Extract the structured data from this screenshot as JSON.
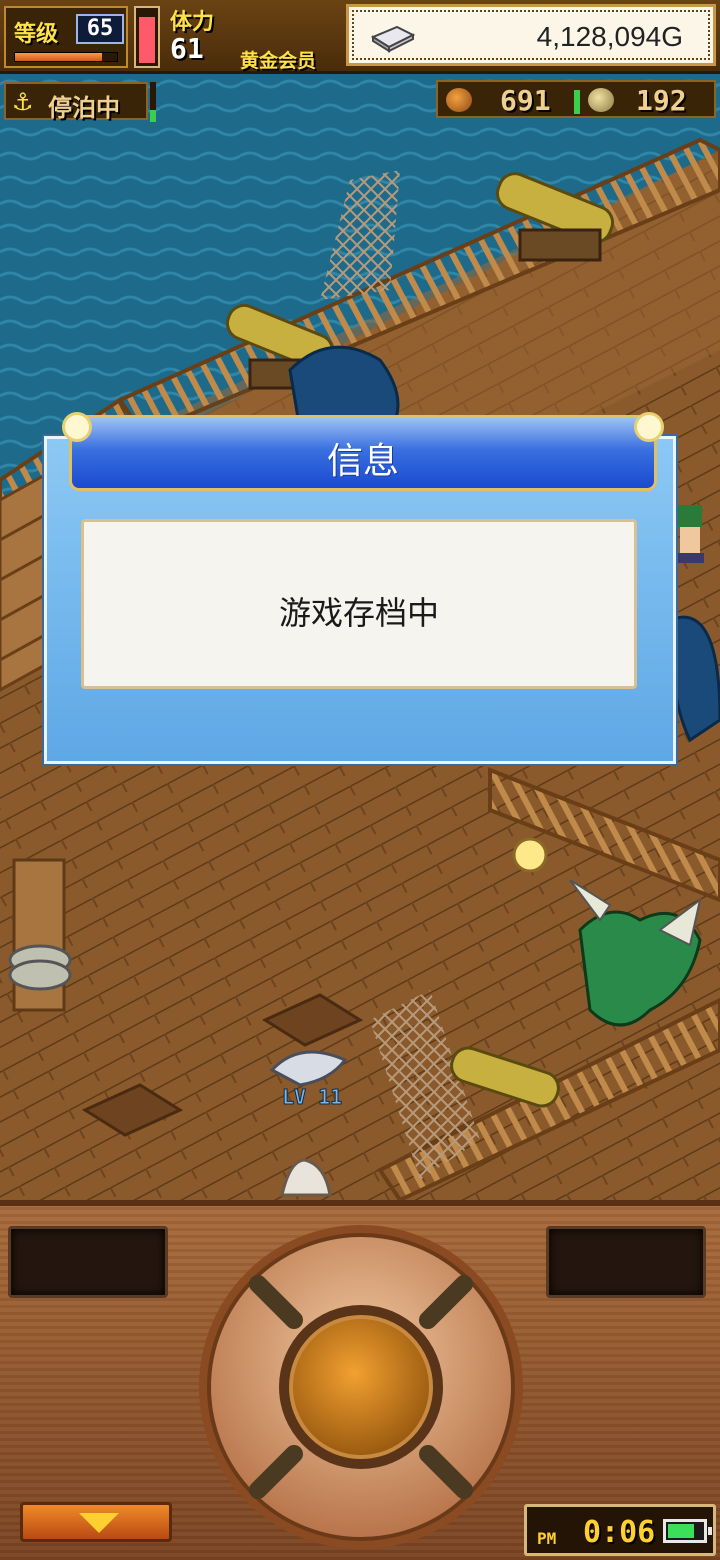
{
  "hud": {
    "level_label": "等级",
    "level": "65",
    "level_progress": 0.85,
    "stamina_label": "体力",
    "stamina": "61",
    "stamina_fill": 0.9,
    "member_label": "黄金会员",
    "gold": "4,128,094G",
    "status_label": "停泊中",
    "resource_1": "691",
    "resource_2": "192"
  },
  "dialog": {
    "title": "信息",
    "message": "游戏存档中"
  },
  "panel": {
    "clock_ampm": "PM",
    "clock_time": "0:06",
    "battery_level": 0.8
  },
  "scene": {
    "characters": [
      {
        "label": "LV 11"
      }
    ]
  },
  "colors": {
    "sea": "#1e6a8a",
    "deck": "#8a5a2c",
    "dialog_header": "#2a5ad8",
    "dialog_panel": "#6cb4ec",
    "gold_text": "#ffe14a"
  },
  "icons": [
    "anchor-icon",
    "silver-bar-icon",
    "coin-icon",
    "battery-icon",
    "down-arrow-icon"
  ]
}
